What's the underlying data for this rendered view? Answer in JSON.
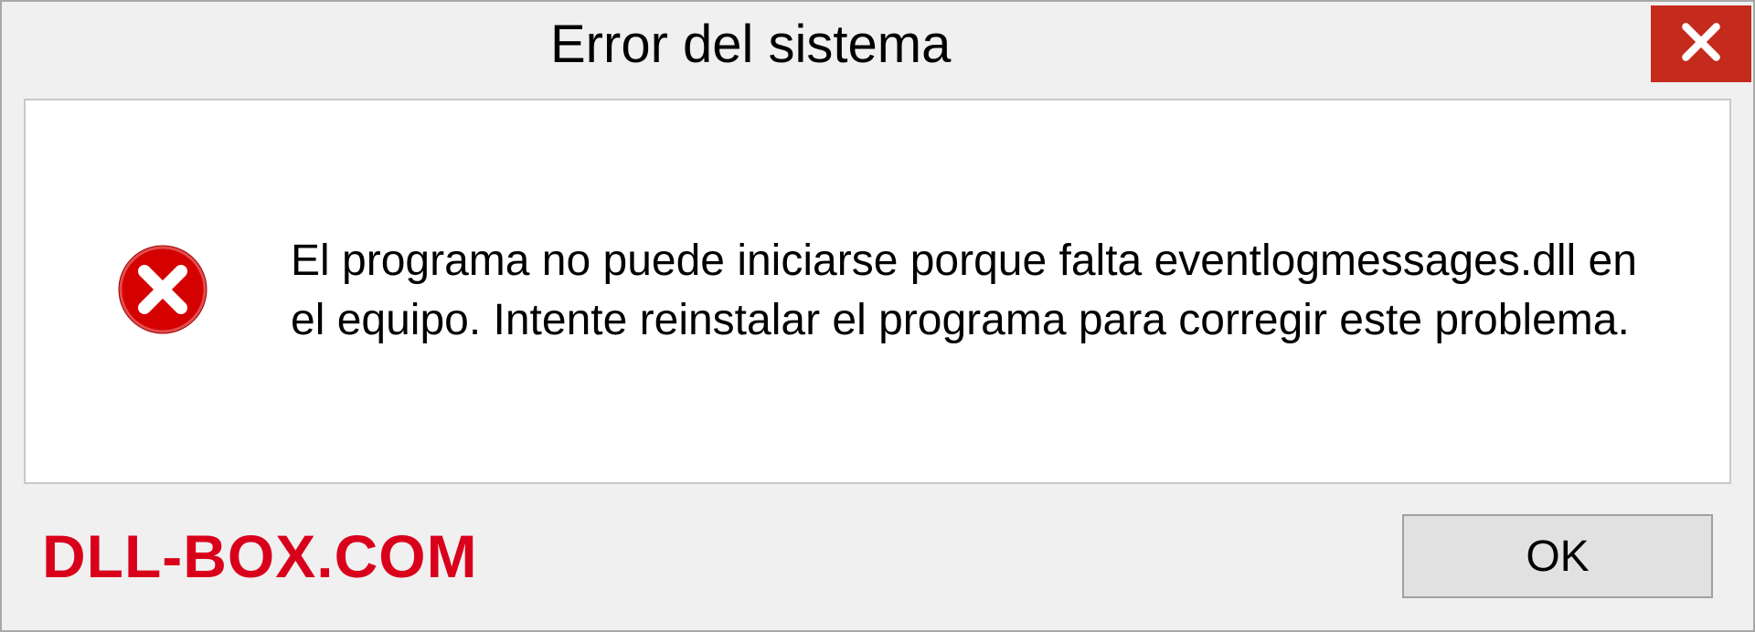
{
  "titlebar": {
    "title": "Error del sistema"
  },
  "content": {
    "message": "El programa no puede iniciarse porque falta eventlogmessages.dll en el equipo. Intente reinstalar el programa para corregir este problema."
  },
  "footer": {
    "watermark": "DLL-BOX.COM",
    "ok_label": "OK"
  },
  "colors": {
    "close_bg": "#c42b1c",
    "error_icon": "#d50000",
    "watermark": "#d9001b"
  }
}
